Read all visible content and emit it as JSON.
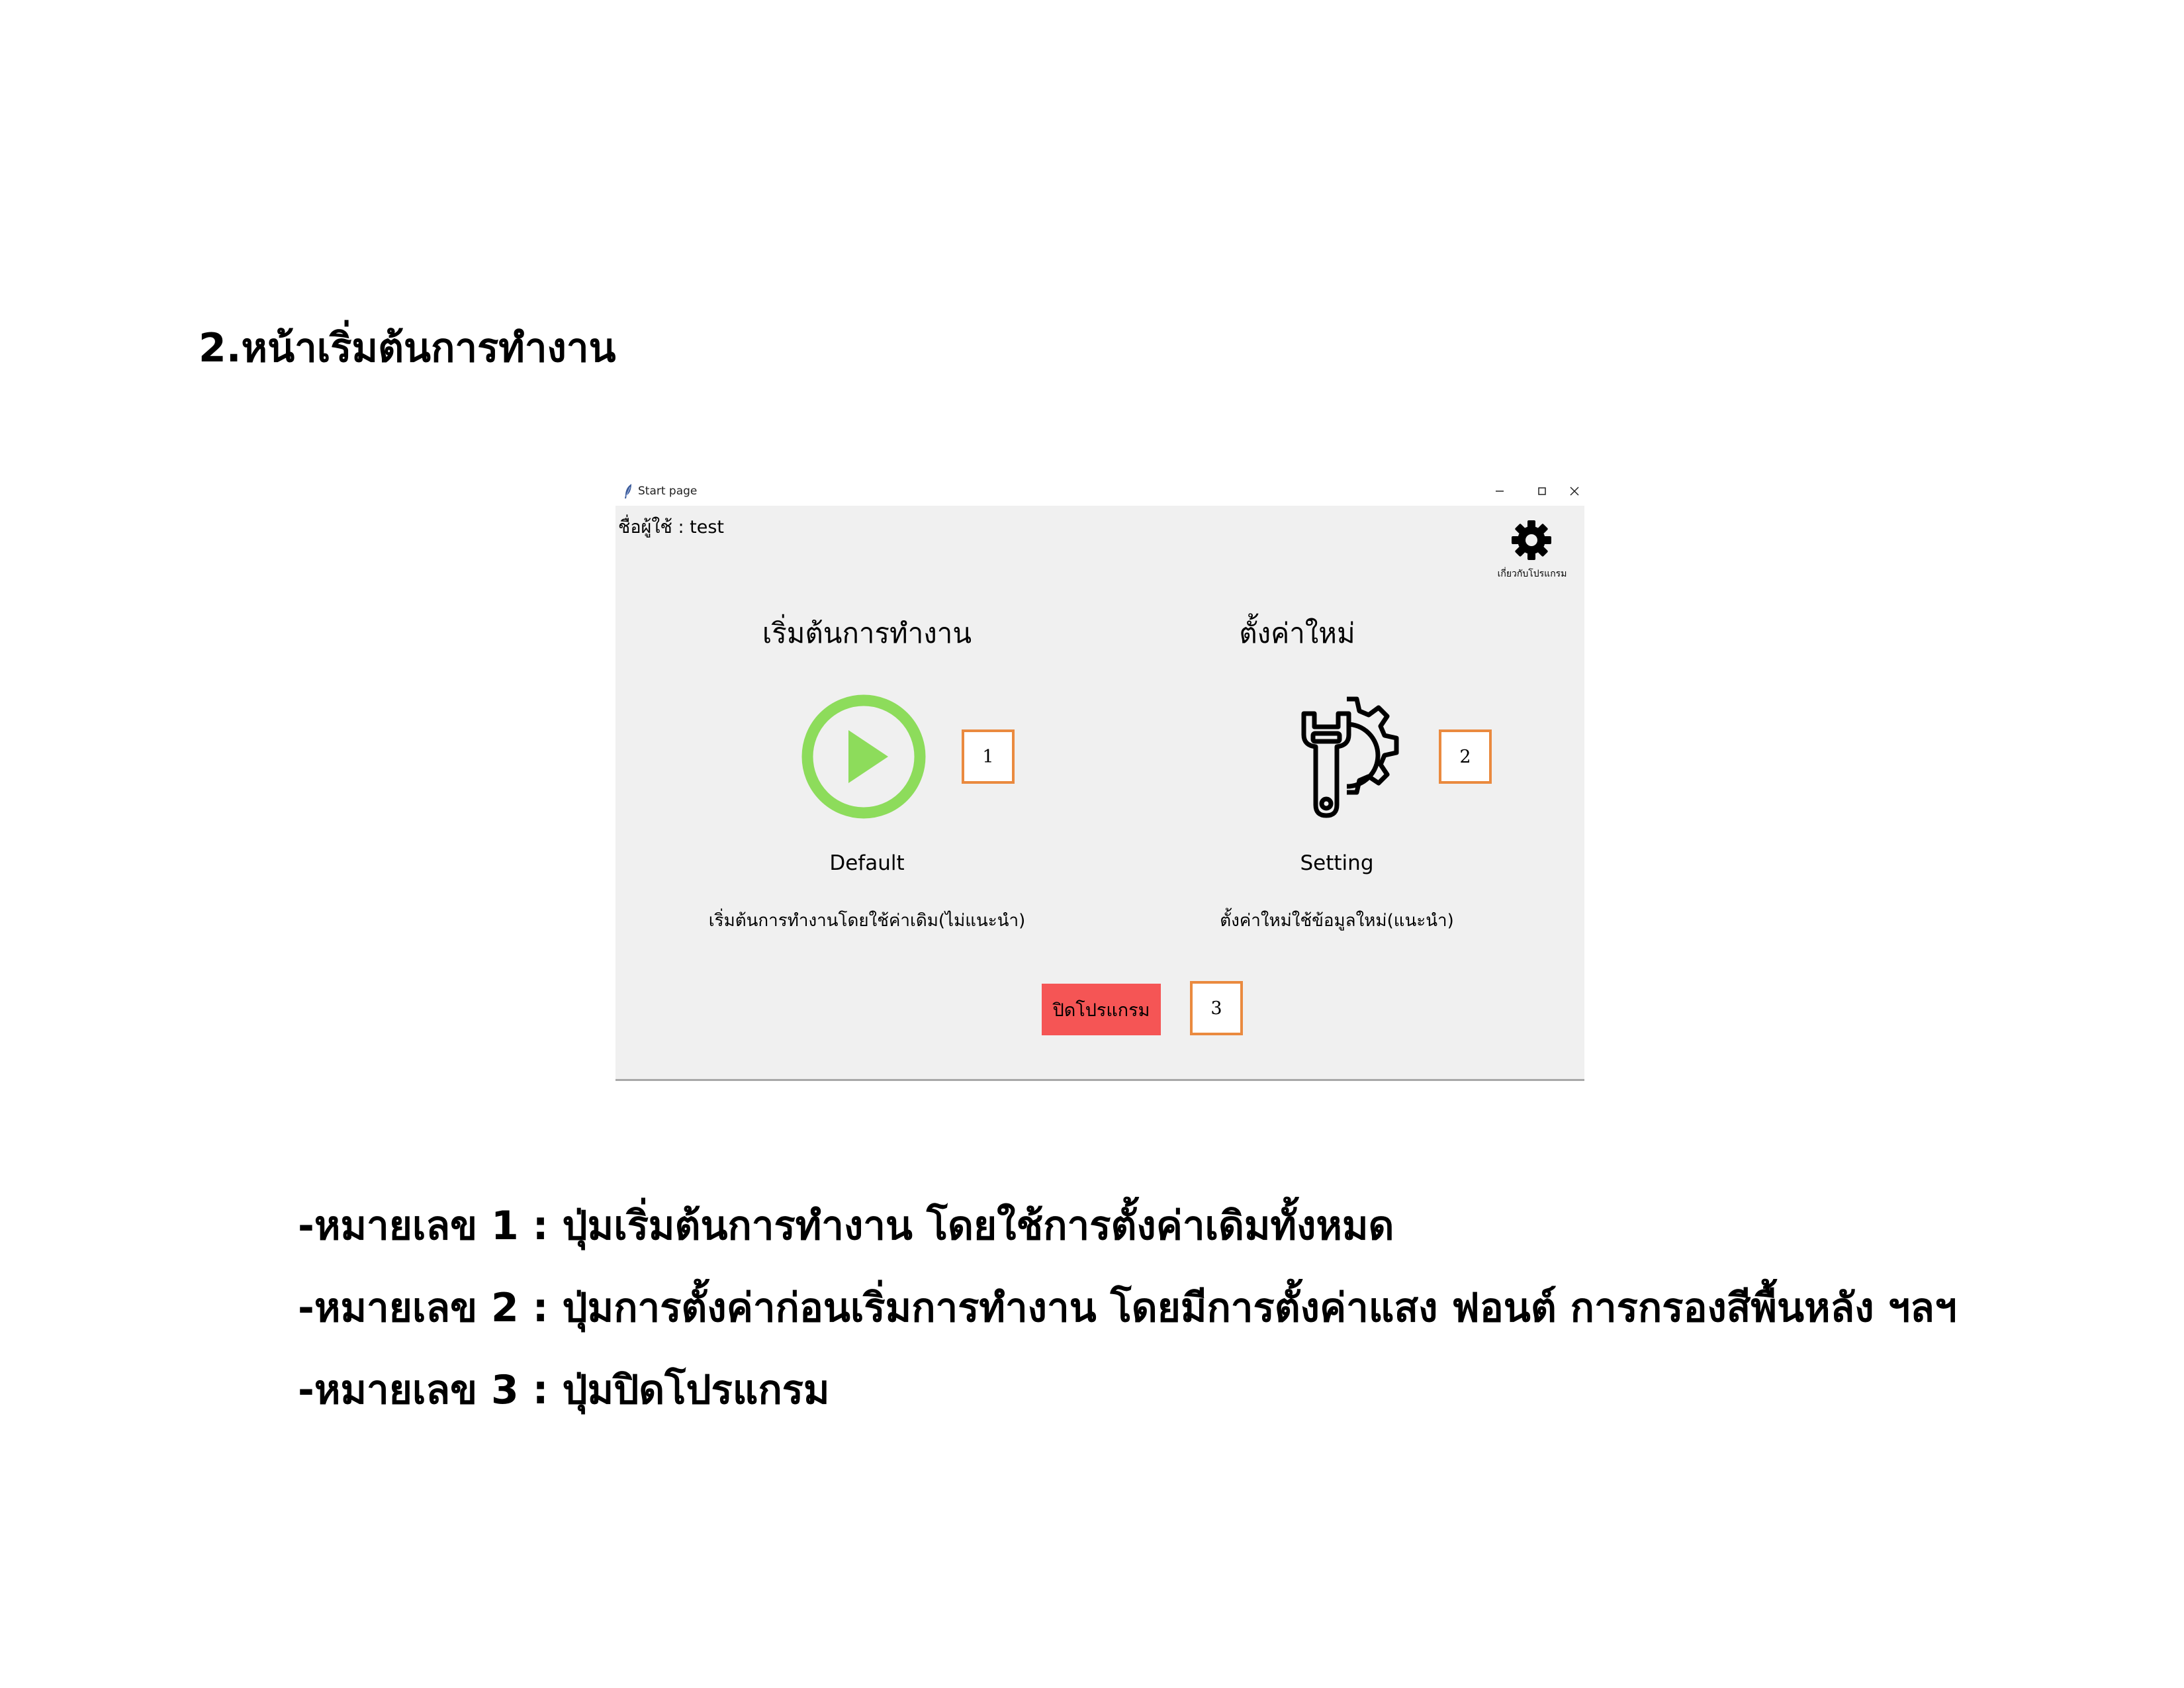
{
  "document": {
    "heading": "2.หน้าเริ่มต้นการทำงาน",
    "notes": [
      "-หมายเลข 1 : ปุ่มเริ่มต้นการทำงาน โดยใช้การตั้งค่าเดิมทั้งหมด",
      "-หมายเลข 2 : ปุ่มการตั้งค่าก่อนเริ่มการทำงาน โดยมีการตั้งค่าแสง ฟอนต์ การกรองสีพื้นหลัง ฯลฯ",
      "-หมายเลข 3 : ปุ่มปิดโปรแกรม"
    ]
  },
  "window": {
    "title": "Start page",
    "username_label": "ชื่อผู้ใช้ : test",
    "about": {
      "icon": "gear-icon",
      "label": "เกี่ยวกับโปรแกรม"
    },
    "default_mode": {
      "title": "เริ่มต้นการทำงาน",
      "icon": "play-icon",
      "label": "Default",
      "description": "เริ่มต้นการทำงานโดยใช้ค่าเดิม(ไม่แนะนำ)",
      "icon_color": "#8ddc5b"
    },
    "setting_mode": {
      "title": "ตั้งค่าใหม่",
      "icon": "wrench-gear-icon",
      "label": "Setting",
      "description": "ตั้งค่าใหม่ใช้ข้อมูลใหม่(แนะนำ)"
    },
    "exit_button": {
      "label": "ปิดโปรแกรม",
      "color": "#f55555"
    }
  },
  "callouts": [
    "1",
    "2",
    "3"
  ],
  "colors": {
    "callout_border": "#ea8a3f",
    "window_background": "#f0f0f0"
  }
}
